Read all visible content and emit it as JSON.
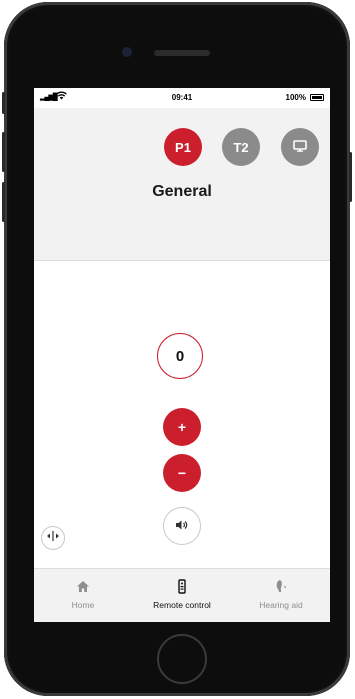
{
  "status_bar": {
    "time": "09:41",
    "battery": "100%"
  },
  "programs": [
    {
      "label": "P1",
      "selected": true
    },
    {
      "label": "T2",
      "selected": false
    },
    {
      "icon": "tv-icon",
      "selected": false
    }
  ],
  "program_name": "General",
  "volume": {
    "value": "0",
    "increase_label": "+",
    "decrease_label": "−"
  },
  "tabs": [
    {
      "label": "Home",
      "icon": "home-icon"
    },
    {
      "label": "Remote control",
      "icon": "remote-icon",
      "active": true
    },
    {
      "label": "Hearing aid",
      "icon": "hearing-aid-icon"
    }
  ],
  "colors": {
    "accent": "#cc1f2d",
    "inactive": "#8b8b8b",
    "header_bg": "#f2f2f2"
  }
}
